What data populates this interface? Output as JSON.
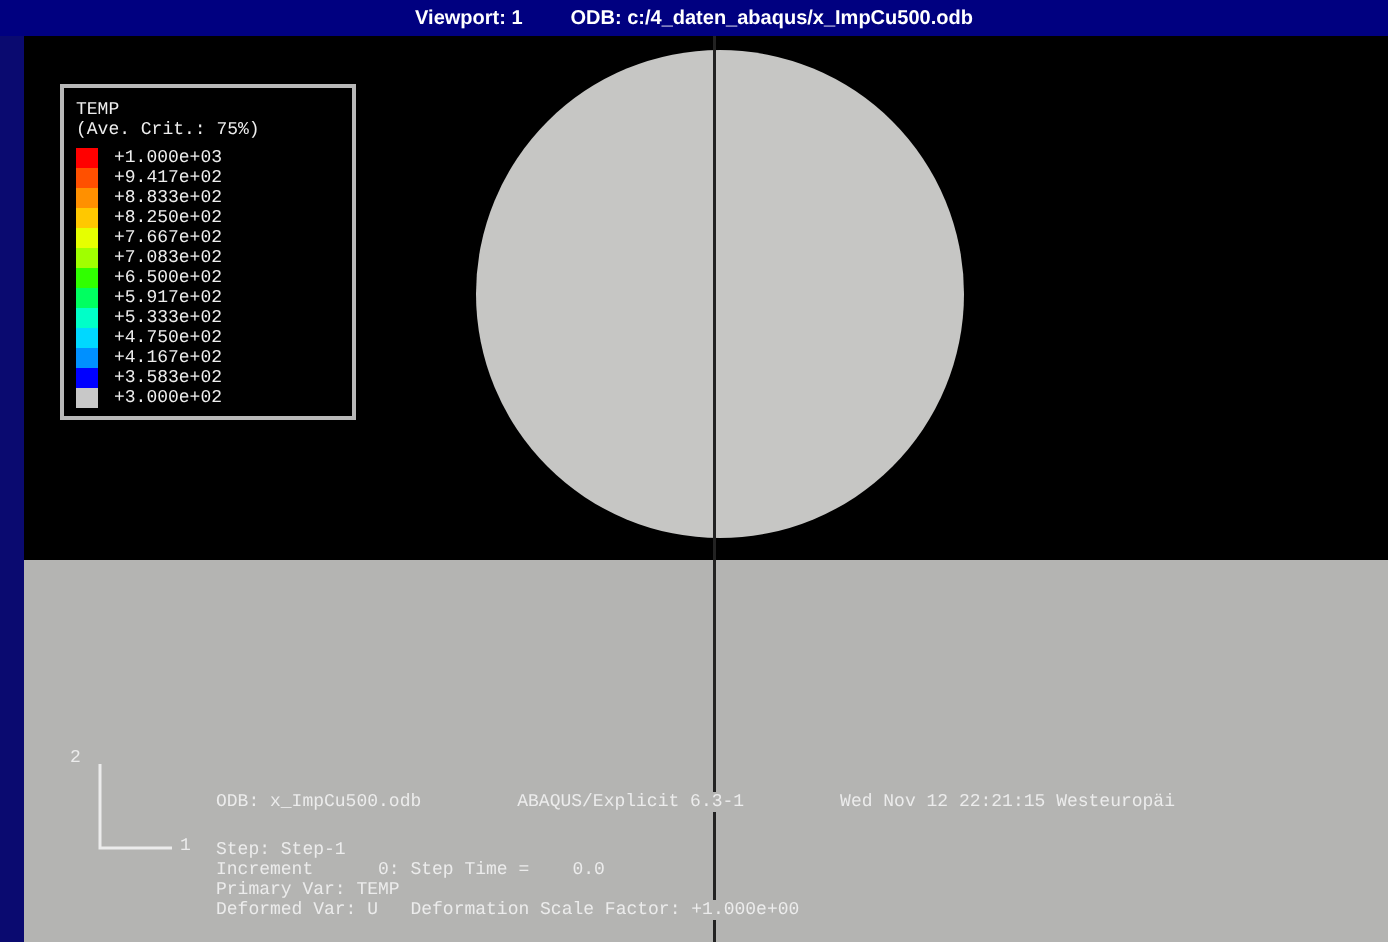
{
  "window": {
    "viewport": "Viewport: 1",
    "odb_path": "ODB: c:/4_daten_abaqus/x_ImpCu500.odb"
  },
  "legend": {
    "variable": "TEMP",
    "criterion": "(Ave. Crit.: 75%)",
    "levels": [
      {
        "label": "+1.000e+03",
        "color": "#ff0000"
      },
      {
        "label": "+9.417e+02",
        "color": "#ff5000"
      },
      {
        "label": "+8.833e+02",
        "color": "#ff9000"
      },
      {
        "label": "+8.250e+02",
        "color": "#ffc800"
      },
      {
        "label": "+7.667e+02",
        "color": "#e6ff00"
      },
      {
        "label": "+7.083e+02",
        "color": "#a0ff00"
      },
      {
        "label": "+6.500e+02",
        "color": "#30ff00"
      },
      {
        "label": "+5.917e+02",
        "color": "#00ff60"
      },
      {
        "label": "+5.333e+02",
        "color": "#00ffc8"
      },
      {
        "label": "+4.750e+02",
        "color": "#00d8ff"
      },
      {
        "label": "+4.167e+02",
        "color": "#0090ff"
      },
      {
        "label": "+3.583e+02",
        "color": "#0000ff"
      },
      {
        "label": "+3.000e+02",
        "color": "#c8c8c8"
      }
    ]
  },
  "triad": {
    "axis_1": "1",
    "axis_2": "2"
  },
  "info": {
    "header": [
      "ODB: x_ImpCu500.odb",
      "ABAQUS/Explicit 6.3-1",
      "Wed Nov 12 22:21:15 Westeuropäi"
    ],
    "lines": [
      "Step: Step-1",
      "Increment      0: Step Time =    0.0",
      "Primary Var: TEMP",
      "Deformed Var: U   Deformation Scale Factor: +1.000e+00"
    ]
  }
}
